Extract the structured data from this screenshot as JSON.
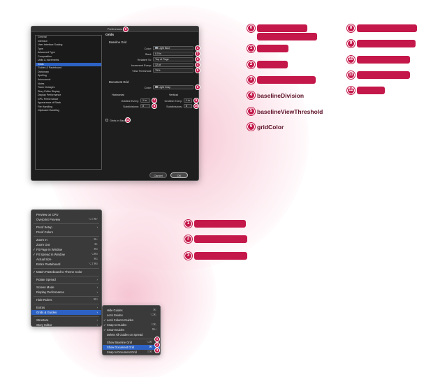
{
  "dialog": {
    "title": "Preferences",
    "categories": [
      "General",
      "Interface",
      "User Interface Scaling",
      "Type",
      "Advanced Type",
      "Composition",
      "Units & Increments",
      "Grids",
      "Guides & Pasteboard",
      "Dictionary",
      "Spelling",
      "Autocorrect",
      "Notes",
      "Track Changes",
      "Story Editor Display",
      "Display Performance",
      "GPU Performance",
      "Appearance of Black",
      "File Handling",
      "Clipboard Handling"
    ],
    "selected_category": "Grids",
    "section_title": "Grids",
    "baseline": {
      "heading": "Baseline Grid",
      "color_label": "Color:",
      "color_value": "Light Blue",
      "start_label": "Start:",
      "start_value": "0.5 in",
      "relative_label": "Relative To:",
      "relative_value": "Top of Page",
      "increment_label": "Increment Every:",
      "increment_value": "12 pt",
      "threshold_label": "View Threshold:",
      "threshold_value": "75%"
    },
    "document": {
      "heading": "Document Grid",
      "color_label": "Color:",
      "color_value": "Light Gray",
      "horizontal_label": "Horizontal",
      "vertical_label": "Vertical",
      "h_gridline_label": "Gridline Every:",
      "h_gridline_value": "1 in",
      "h_subdiv_label": "Subdivisions:",
      "h_subdiv_value": "8",
      "v_gridline_label": "Gridline Every:",
      "v_gridline_value": "1 in",
      "v_subdiv_label": "Subdivisions:",
      "v_subdiv_value": "8"
    },
    "grids_in_back_label": "Grids in Back",
    "cancel_label": "Cancel",
    "ok_label": "OK"
  },
  "badges": {
    "b0": "0",
    "b1": "1",
    "b2": "2",
    "b3": "3",
    "b4": "4",
    "b5": "5",
    "b6": "6",
    "b7": "7",
    "b8": "8",
    "b9": "9",
    "b10": "10",
    "b11": "11",
    "b12": "12",
    "m1": "1",
    "m2": "2",
    "m3": "3"
  },
  "legend": {
    "l0": "0",
    "l1": "1",
    "l2": "2",
    "l3": "3",
    "l4": "4",
    "l5": "5",
    "l6": "6",
    "l7": "7",
    "l4_text": "baselineDivision",
    "l6_text": "baselineViewThreshold",
    "l7_text": "gridColor",
    "l8": "8",
    "l9": "9",
    "l10": "10",
    "l11": "11",
    "l12": "12",
    "r1": "1",
    "r2": "2",
    "r3": "3"
  },
  "view_menu": {
    "items": [
      {
        "label": "Preview on CPU",
        "shortcut": ""
      },
      {
        "label": "Overprint Preview",
        "shortcut": "⌥⇧⌘Y"
      },
      {
        "label": "Proof Setup",
        "shortcut": "›"
      },
      {
        "label": "Proof Colors",
        "shortcut": ""
      },
      {
        "label": "Zoom In",
        "shortcut": "⌘="
      },
      {
        "label": "Zoom Out",
        "shortcut": "⌘-"
      },
      {
        "label": "Fit Page in Window",
        "shortcut": "⌘0"
      },
      {
        "label": "Fit Spread in Window",
        "shortcut": "⌥⌘0"
      },
      {
        "label": "Actual Size",
        "shortcut": "⌘1"
      },
      {
        "label": "Entire Pasteboard",
        "shortcut": "⌥⇧⌘0"
      },
      {
        "label": "Match Pasteboard to Theme Color",
        "shortcut": ""
      },
      {
        "label": "Rotate Spread",
        "shortcut": "›"
      },
      {
        "label": "Screen Mode",
        "shortcut": "›"
      },
      {
        "label": "Display Performance",
        "shortcut": "›"
      },
      {
        "label": "Hide Rulers",
        "shortcut": "⌘R"
      },
      {
        "label": "Extras",
        "shortcut": "›"
      },
      {
        "label": "Grids & Guides",
        "shortcut": "›"
      },
      {
        "label": "Structure",
        "shortcut": "›"
      },
      {
        "label": "Story Editor",
        "shortcut": "›"
      }
    ]
  },
  "grids_submenu": {
    "items": [
      {
        "label": "Hide Guides",
        "shortcut": "⌘;"
      },
      {
        "label": "Lock Guides",
        "shortcut": "⌥⌘;"
      },
      {
        "label": "Lock Column Guides",
        "shortcut": ""
      },
      {
        "label": "Snap to Guides",
        "shortcut": "⇧⌘;"
      },
      {
        "label": "Smart Guides",
        "shortcut": "⌘U"
      },
      {
        "label": "Delete All Guides on Spread",
        "shortcut": ""
      },
      {
        "label": "Show Baseline Grid",
        "shortcut": "⌥⌘'"
      },
      {
        "label": "Show Document Grid",
        "shortcut": "⌘'"
      },
      {
        "label": "Snap to Document Grid",
        "shortcut": "⇧⌘'"
      }
    ]
  },
  "colors": {
    "accent": "#c4184a",
    "highlight": "#2d62c4",
    "light_blue": "#8fb8f0",
    "light_gray": "#c8c8c8"
  }
}
